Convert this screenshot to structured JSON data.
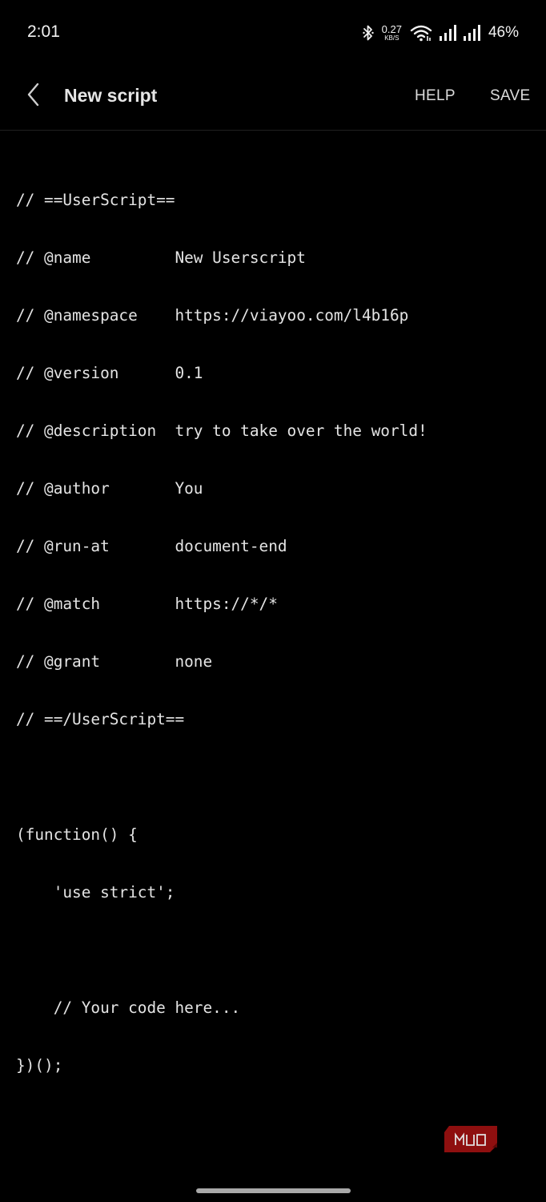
{
  "status_bar": {
    "time": "2:01",
    "net_speed_value": "0.27",
    "net_speed_unit": "KB/S",
    "battery": "46%",
    "icons": [
      "bluetooth-icon",
      "wifi-icon",
      "signal-icon",
      "signal-icon"
    ]
  },
  "app_bar": {
    "title": "New script",
    "help_label": "HELP",
    "save_label": "SAVE",
    "back_icon": "back-chevron-icon"
  },
  "editor": {
    "lines": [
      "// ==UserScript==",
      "// @name         New Userscript",
      "// @namespace    https://viayoo.com/l4b16p",
      "// @version      0.1",
      "// @description  try to take over the world!",
      "// @author       You",
      "// @run-at       document-end",
      "// @match        https://*/*",
      "// @grant        none",
      "// ==/UserScript==",
      "",
      "(function() {",
      "    'use strict';",
      "",
      "    // Your code here...",
      "})();"
    ]
  },
  "watermark": {
    "text": "MUO",
    "color": "#9b1010"
  },
  "colors": {
    "background": "#000000",
    "text": "#e4e4e4"
  }
}
